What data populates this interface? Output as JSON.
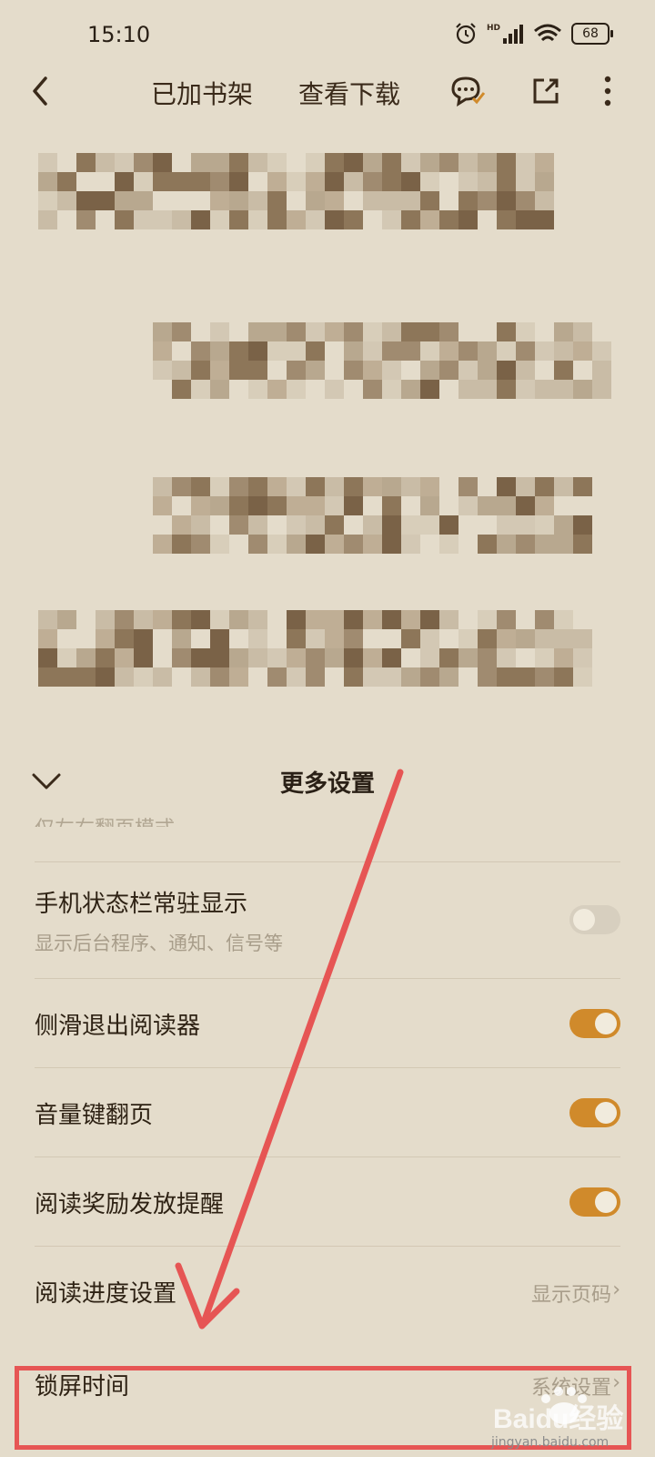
{
  "status": {
    "time": "15:10",
    "network": "HD",
    "battery": "68"
  },
  "nav": {
    "back_label": "<",
    "bookshelf_label": "已加书架",
    "download_label": "查看下载"
  },
  "settings": {
    "title": "更多设置",
    "partial_item": "仅左右翻页模式",
    "items": [
      {
        "label": "手机状态栏常驻显示",
        "sub": "显示后台程序、通知、信号等",
        "state": "off"
      },
      {
        "label": "侧滑退出阅读器",
        "state": "on"
      },
      {
        "label": "音量键翻页",
        "state": "on"
      },
      {
        "label": "阅读奖励发放提醒",
        "state": "on"
      },
      {
        "label": "阅读进度设置",
        "value": "显示页码"
      },
      {
        "label": "锁屏时间",
        "value": "系统设置"
      }
    ]
  },
  "watermark": {
    "logo": "Baidu经验",
    "url": "jingyan.baidu.com"
  },
  "colors": {
    "accent": "#d08a2b",
    "background": "#e4dccb",
    "annotation": "#e65554",
    "text": "#2e2214"
  }
}
